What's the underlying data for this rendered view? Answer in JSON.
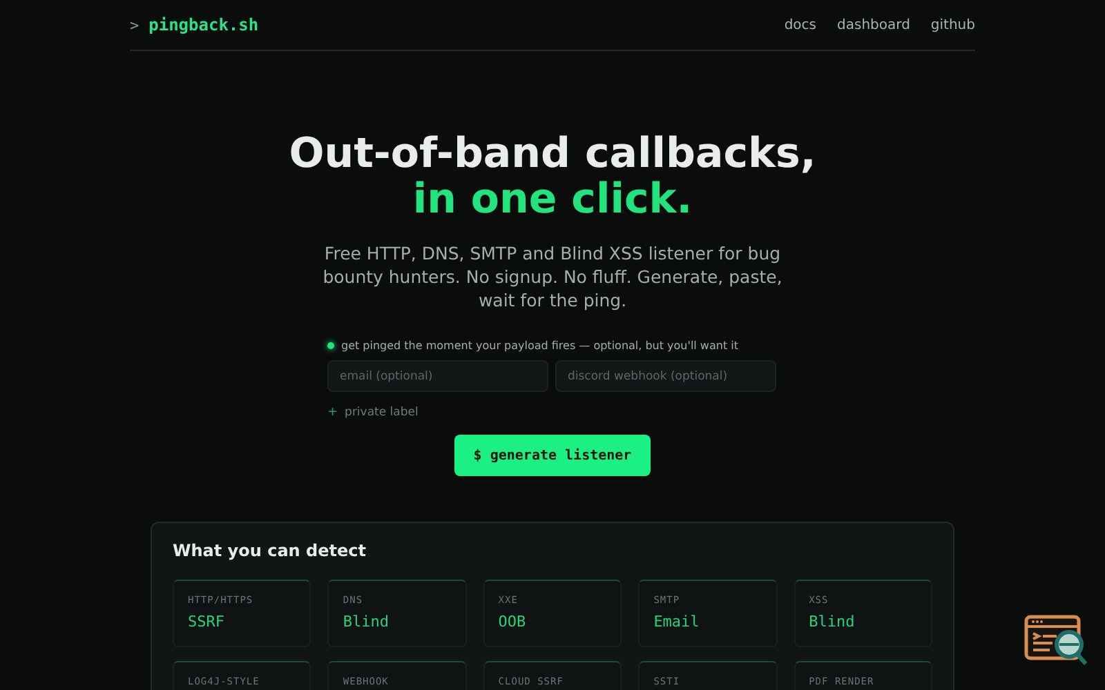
{
  "header": {
    "prompt": ">",
    "logo": "pingback.sh",
    "nav": [
      "docs",
      "dashboard",
      "github"
    ]
  },
  "hero": {
    "title": "Out-of-band callbacks,",
    "highlight": "in one click.",
    "subtitle": "Free HTTP, DNS, SMTP and Blind XSS listener for bug bounty hunters. No signup. No fluff. Generate, paste, wait for the ping."
  },
  "notify": {
    "note": "get pinged the moment your payload fires — optional, but you'll want it",
    "fields": [
      {
        "placeholder": "email (optional)"
      },
      {
        "placeholder": "discord webhook (optional)"
      }
    ],
    "private_label": {
      "icon": "+",
      "text": "private label"
    }
  },
  "button": "$ generate listener",
  "detect": {
    "title": "What you can detect",
    "tiles": [
      {
        "label": "HTTP/HTTPS",
        "value": "SSRF"
      },
      {
        "label": "DNS",
        "value": "Blind"
      },
      {
        "label": "XXE",
        "value": "OOB"
      },
      {
        "label": "SMTP",
        "value": "Email"
      },
      {
        "label": "XSS",
        "value": "Blind"
      },
      {
        "label": "LOG4J-STYLE"
      },
      {
        "label": "WEBHOOK"
      },
      {
        "label": "CLOUD SSRF"
      },
      {
        "label": "SSTI"
      },
      {
        "label": "PDF RENDER"
      }
    ]
  }
}
